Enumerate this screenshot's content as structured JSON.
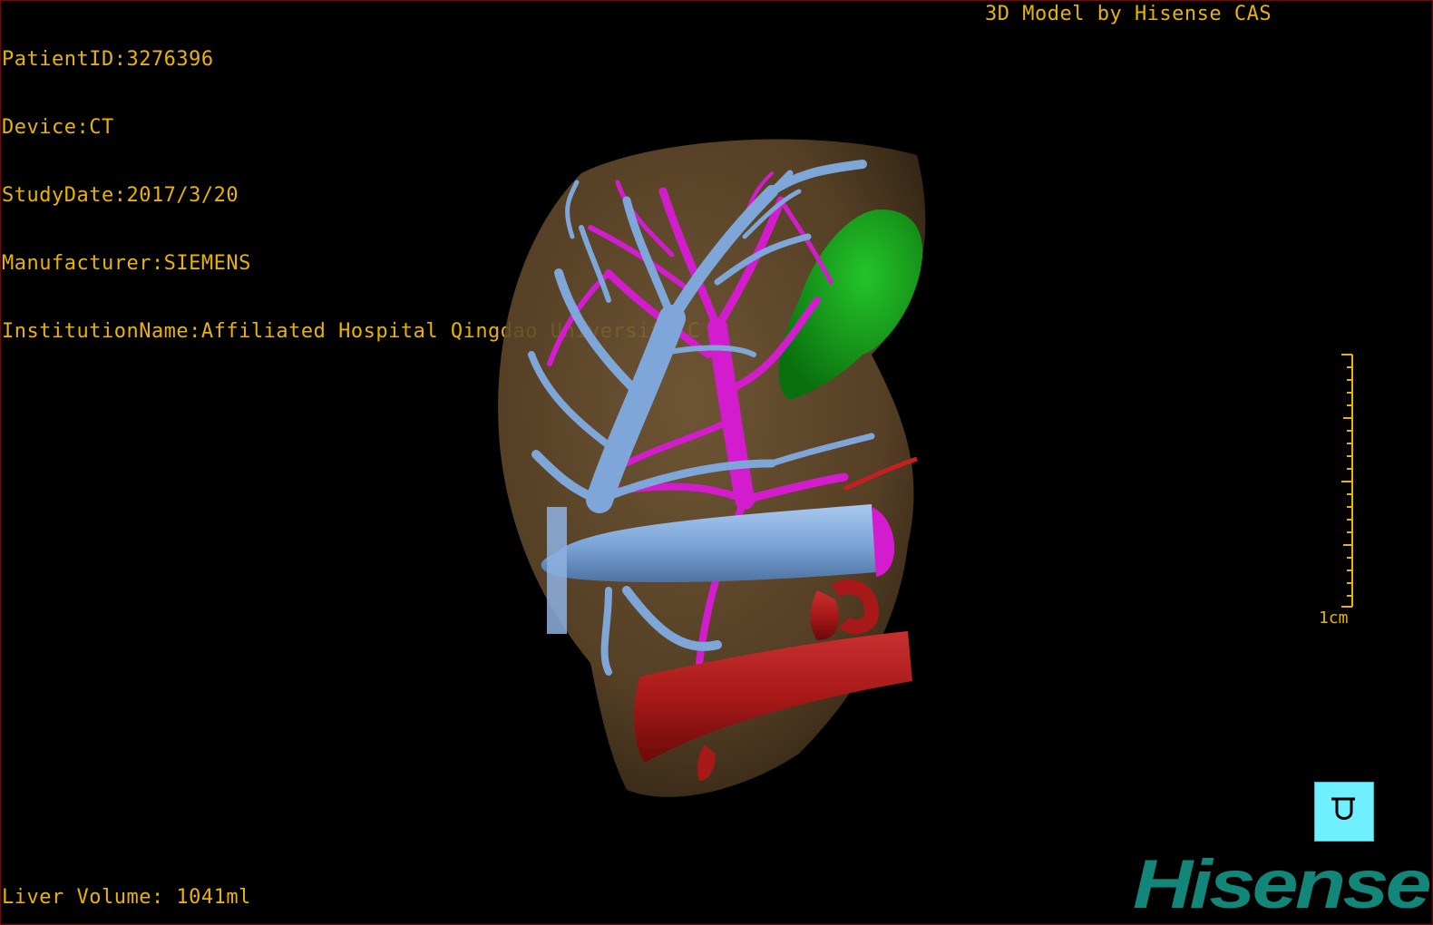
{
  "dicom": {
    "patient_id": "PatientID:3276396",
    "device": "Device:CT",
    "study_date": "StudyDate:2017/3/20",
    "manufacturer": "Manufacturer:SIEMENS",
    "institution": "InstitutionName:Affiliated Hospital Qingdao University-C"
  },
  "brand_caption": "3D Model by Hisense CAS",
  "liver_volume": "Liver Volume: 1041ml",
  "scale": {
    "label": "1cm"
  },
  "logo": {
    "text": "Hisense",
    "color": "#13867a"
  },
  "colors": {
    "overlay_text": "#e8b400",
    "liver": "#6b5233",
    "hepatic_vein": "#7ea6d8",
    "portal_vein": "#d41ccf",
    "artery_vena_cava": "#a81818",
    "lesion": "#0e9a14",
    "orientation_cube": "#6ff0ff"
  },
  "icons": {
    "orientation": "orientation-cube-icon"
  }
}
